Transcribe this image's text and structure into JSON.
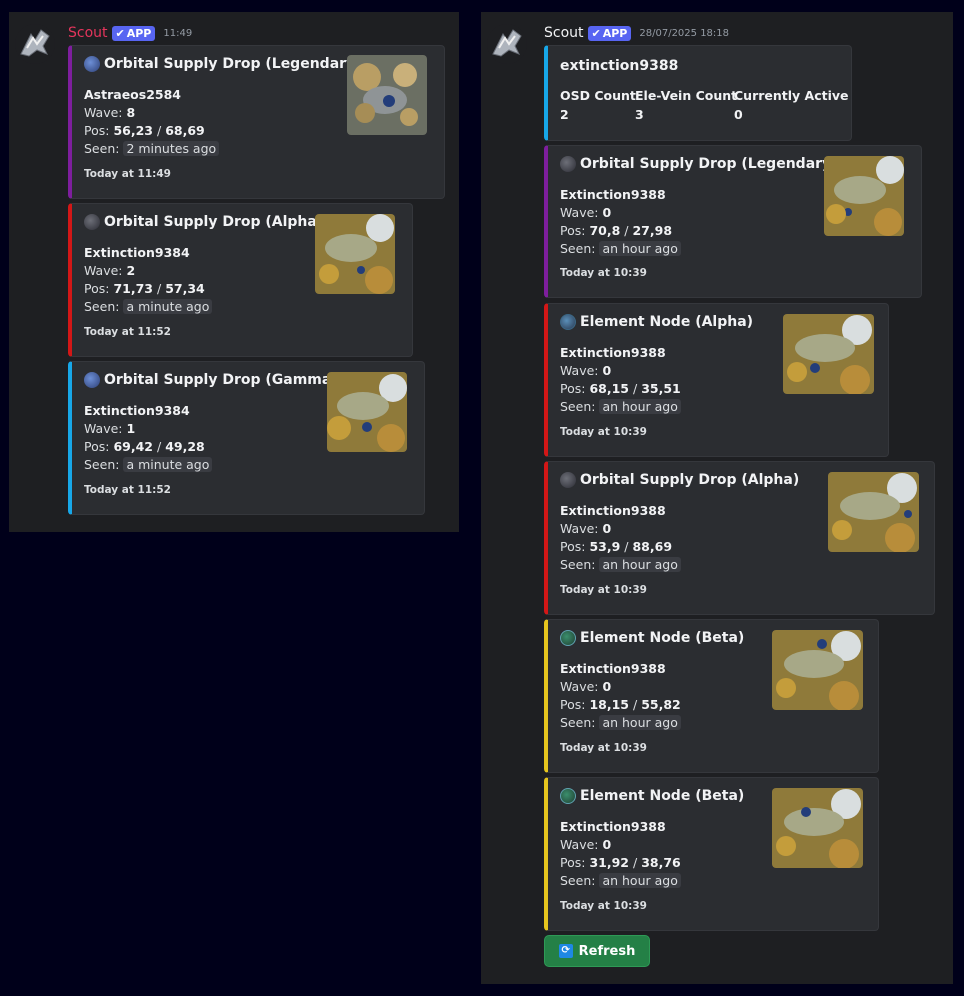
{
  "colors": {
    "legendary": "#7e1e9e",
    "alpha": "#d31717",
    "gamma": "#17a7e8",
    "beta": "#e6c51e",
    "username": "#e4355c",
    "accent": "#5865f2",
    "button": "#248046"
  },
  "left": {
    "author": "Scout",
    "badge": "APP",
    "time": "11:49",
    "embeds": [
      {
        "title": "Orbital Supply Drop (Legendary)",
        "player": "Astraeos2584",
        "wave_label": "Wave:",
        "wave": "8",
        "pos_label": "Pos:",
        "pos_x": "56,23",
        "pos_sep": "/",
        "pos_y": "68,69",
        "seen_label": "Seen:",
        "seen": "2 minutes ago",
        "footer": "Today at 11:49",
        "icon": "orbital-drop-icon"
      },
      {
        "title": "Orbital Supply Drop (Alpha)",
        "player": "Extinction9384",
        "wave_label": "Wave:",
        "wave": "2",
        "pos_label": "Pos:",
        "pos_x": "71,73",
        "pos_sep": "/",
        "pos_y": "57,34",
        "seen_label": "Seen:",
        "seen": "a minute ago",
        "footer": "Today at 11:52",
        "icon": "orbital-drop-icon"
      },
      {
        "title": "Orbital Supply Drop (Gamma)",
        "player": "Extinction9384",
        "wave_label": "Wave:",
        "wave": "1",
        "pos_label": "Pos:",
        "pos_x": "69,42",
        "pos_sep": "/",
        "pos_y": "49,28",
        "seen_label": "Seen:",
        "seen": "a minute ago",
        "footer": "Today at 11:52",
        "icon": "orbital-drop-icon"
      }
    ]
  },
  "right": {
    "author": "Scout",
    "badge": "APP",
    "time": "28/07/2025 18:18",
    "summary": {
      "title": "extinction9388",
      "headers": [
        "OSD Count",
        "Ele-Vein Count",
        "Currently Active"
      ],
      "values": [
        "2",
        "3",
        "0"
      ]
    },
    "embeds": [
      {
        "title": "Orbital Supply Drop (Legendary)",
        "player": "Extinction9388",
        "wave_label": "Wave:",
        "wave": "0",
        "pos_label": "Pos:",
        "pos_x": "70,8",
        "pos_sep": "/",
        "pos_y": "27,98",
        "seen_label": "Seen:",
        "seen": "an hour ago",
        "footer": "Today at 10:39",
        "icon": "orbital-drop-icon"
      },
      {
        "title": "Element Node (Alpha)",
        "player": "Extinction9388",
        "wave_label": "Wave:",
        "wave": "0",
        "pos_label": "Pos:",
        "pos_x": "68,15",
        "pos_sep": "/",
        "pos_y": "35,51",
        "seen_label": "Seen:",
        "seen": "an hour ago",
        "footer": "Today at 10:39",
        "icon": "element-node-icon"
      },
      {
        "title": "Orbital Supply Drop (Alpha)",
        "player": "Extinction9388",
        "wave_label": "Wave:",
        "wave": "0",
        "pos_label": "Pos:",
        "pos_x": "53,9",
        "pos_sep": "/",
        "pos_y": "88,69",
        "seen_label": "Seen:",
        "seen": "an hour ago",
        "footer": "Today at 10:39",
        "icon": "orbital-drop-icon"
      },
      {
        "title": "Element Node (Beta)",
        "player": "Extinction9388",
        "wave_label": "Wave:",
        "wave": "0",
        "pos_label": "Pos:",
        "pos_x": "18,15",
        "pos_sep": "/",
        "pos_y": "55,82",
        "seen_label": "Seen:",
        "seen": "an hour ago",
        "footer": "Today at 10:39",
        "icon": "element-node-icon"
      },
      {
        "title": "Element Node (Beta)",
        "player": "Extinction9388",
        "wave_label": "Wave:",
        "wave": "0",
        "pos_label": "Pos:",
        "pos_x": "31,92",
        "pos_sep": "/",
        "pos_y": "38,76",
        "seen_label": "Seen:",
        "seen": "an hour ago",
        "footer": "Today at 10:39",
        "icon": "element-node-icon"
      }
    ],
    "refresh_label": "Refresh",
    "refresh_icon": "refresh-icon"
  }
}
